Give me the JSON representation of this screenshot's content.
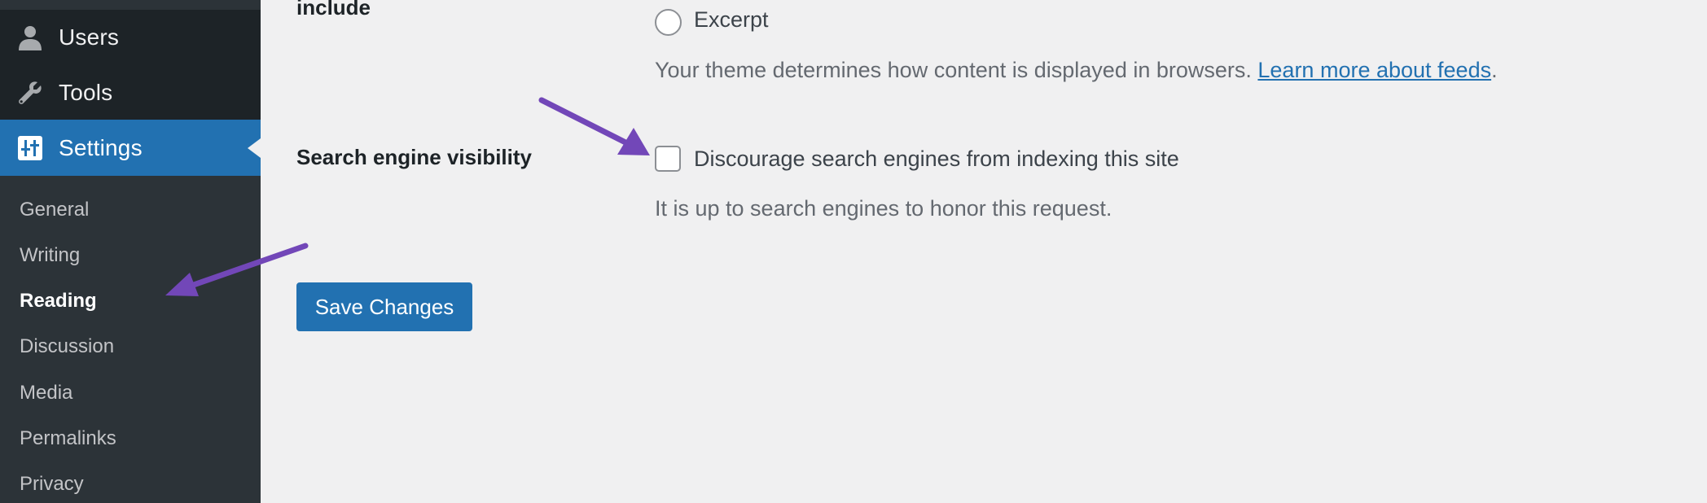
{
  "sidebar": {
    "top_items": [
      {
        "label": "Users",
        "icon": "user-icon"
      },
      {
        "label": "Tools",
        "icon": "wrench-icon"
      },
      {
        "label": "Settings",
        "icon": "settings-sliders-icon",
        "active": true
      }
    ],
    "submenu": [
      {
        "label": "General"
      },
      {
        "label": "Writing"
      },
      {
        "label": "Reading",
        "current": true
      },
      {
        "label": "Discussion"
      },
      {
        "label": "Media"
      },
      {
        "label": "Permalinks"
      },
      {
        "label": "Privacy"
      }
    ]
  },
  "form": {
    "feed_row": {
      "label_fragment": "include",
      "option_excerpt": "Excerpt",
      "description": "Your theme determines how content is displayed in browsers. ",
      "link_text": "Learn more about feeds",
      "trailing": "."
    },
    "search_visibility": {
      "label": "Search engine visibility",
      "checkbox_label": "Discourage search engines from indexing this site",
      "checked": false,
      "description": "It is up to search engines to honor this request."
    },
    "save_label": "Save Changes"
  },
  "colors": {
    "accent": "#2271b1",
    "sidebar_dark": "#1d2327",
    "submenu_bg": "#2c3338",
    "page_bg": "#f0f0f1",
    "annotation_arrow": "#7247b8"
  }
}
